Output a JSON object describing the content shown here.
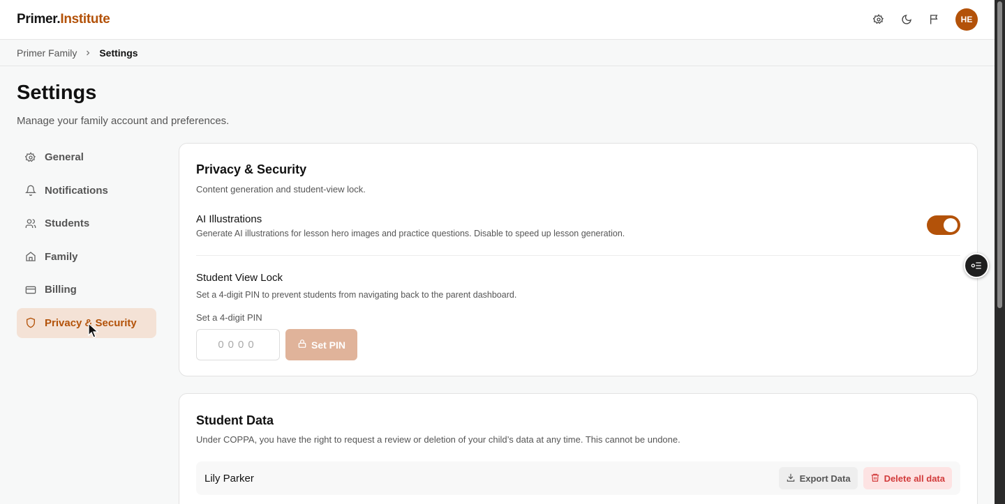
{
  "app": {
    "logo_primary": "Primer.",
    "logo_accent": "Institute",
    "avatar_initials": "HE",
    "accent_color": "#b35209"
  },
  "topbar": {
    "icons": [
      "settings-icon",
      "moon-icon",
      "flag-icon"
    ]
  },
  "breadcrumb": {
    "parent": "Primer Family",
    "current": "Settings"
  },
  "header": {
    "title": "Settings",
    "subtitle": "Manage your family account and preferences."
  },
  "sidebar": {
    "items": [
      {
        "label": "General",
        "icon": "gear-icon"
      },
      {
        "label": "Notifications",
        "icon": "bell-icon"
      },
      {
        "label": "Students",
        "icon": "users-icon"
      },
      {
        "label": "Family",
        "icon": "home-icon"
      },
      {
        "label": "Billing",
        "icon": "credit-card-icon"
      },
      {
        "label": "Privacy & Security",
        "icon": "shield-icon",
        "active": true
      }
    ]
  },
  "privacy": {
    "title": "Privacy & Security",
    "description": "Content generation and student-view lock.",
    "ai_title": "AI Illustrations",
    "ai_desc": "Generate AI illustrations for lesson hero images and practice questions. Disable to speed up lesson generation.",
    "ai_enabled": true,
    "lock_title": "Student View Lock",
    "lock_desc": "Set a 4-digit PIN to prevent students from navigating back to the parent dashboard.",
    "pin_label": "Set a 4-digit PIN",
    "pin_placeholder": "0000",
    "set_pin_label": "Set PIN"
  },
  "student_data": {
    "title": "Student Data",
    "description": "Under COPPA, you have the right to request a review or deletion of your child’s data at any time. This cannot be undone.",
    "students": [
      {
        "name": "Lily Parker",
        "export_label": "Export Data",
        "delete_label": "Delete all data"
      }
    ]
  }
}
